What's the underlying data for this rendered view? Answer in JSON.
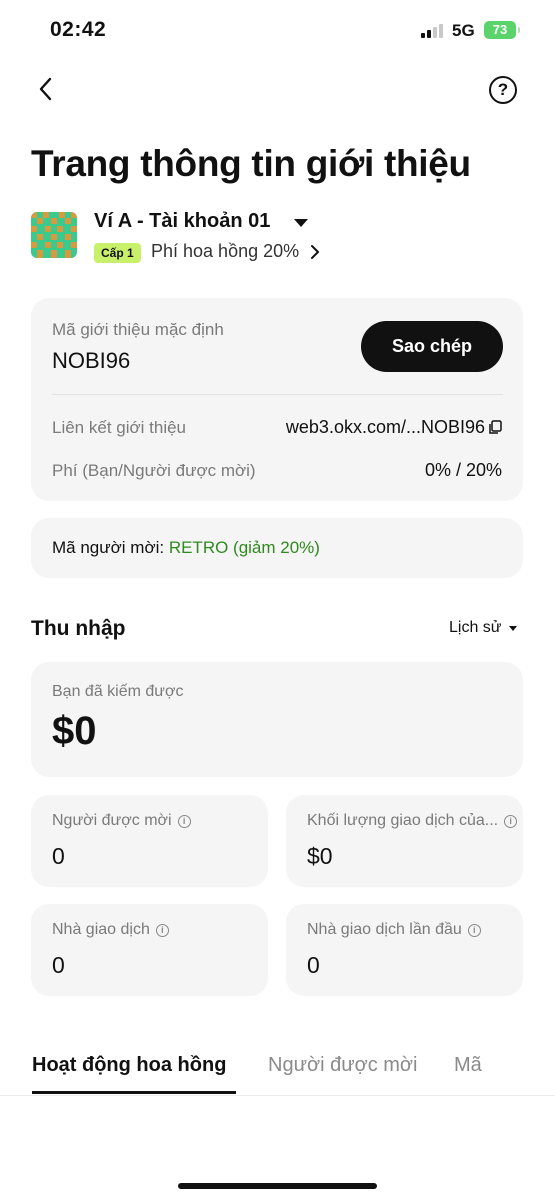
{
  "status_bar": {
    "time": "02:42",
    "network": "5G",
    "battery": "73"
  },
  "header": {
    "back_icon": "chevron-left-icon",
    "help_label": "?"
  },
  "page": {
    "title": "Trang thông tin giới thiệu"
  },
  "wallet": {
    "name": "Ví A - Tài khoản 01",
    "level": "Cấp 1",
    "commission": "Phí hoa hồng 20%"
  },
  "referral": {
    "code_label": "Mã giới thiệu mặc định",
    "code": "NOBI96",
    "copy_button": "Sao chép",
    "link_label": "Liên kết giới thiệu",
    "link_value": "web3.okx.com/...NOBI96",
    "fee_label": "Phí (Bạn/Người được mời)",
    "fee_value": "0% / 20%"
  },
  "inviter": {
    "label": "Mã người mời: ",
    "code": "RETRO (giảm 20%)"
  },
  "income": {
    "title": "Thu nhập",
    "history": "Lịch sử",
    "earned_label": "Bạn đã kiếm được",
    "earned_value": "$0",
    "stats": [
      {
        "label": "Người được mời",
        "value": "0"
      },
      {
        "label": "Khối lượng giao dịch của...",
        "value": "$0"
      },
      {
        "label": "Nhà giao dịch",
        "value": "0"
      },
      {
        "label": "Nhà giao dịch lần đầu",
        "value": "0"
      }
    ]
  },
  "tabs": [
    "Hoạt động hoa hồng",
    "Người được mời",
    "Mã"
  ],
  "colors": {
    "accent_green": "#2f8a1f",
    "badge_green": "#c9f06a",
    "card_bg": "#f5f5f5",
    "battery_green": "#5ad36b"
  }
}
